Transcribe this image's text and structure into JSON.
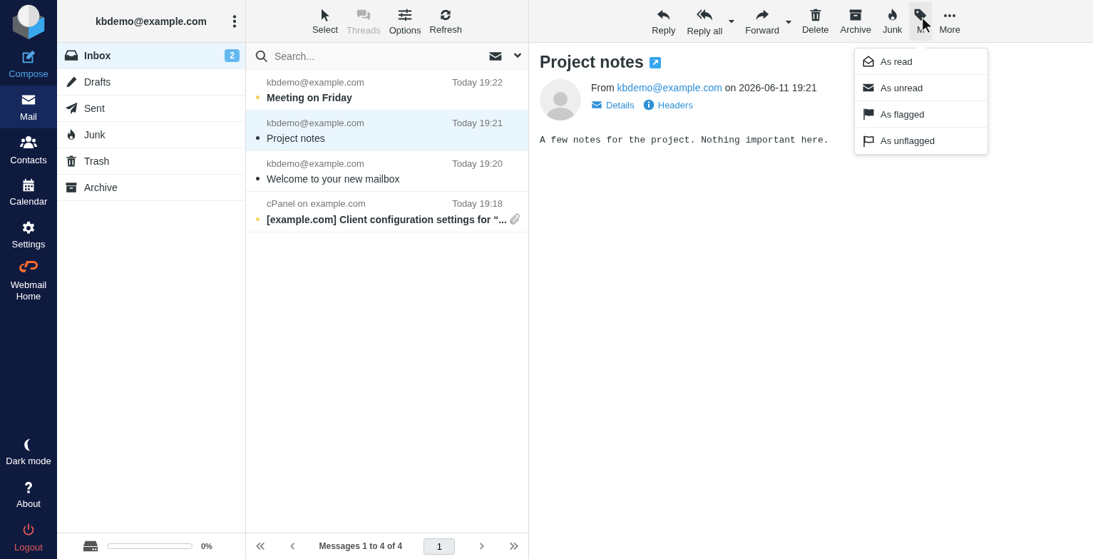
{
  "nav": {
    "items": [
      {
        "label": "Compose",
        "kind": "action",
        "selected": false
      },
      {
        "label": "Mail",
        "kind": "section",
        "selected": true
      },
      {
        "label": "Contacts",
        "kind": "section",
        "selected": false
      },
      {
        "label": "Calendar",
        "kind": "section",
        "selected": false
      },
      {
        "label": "Settings",
        "kind": "section",
        "selected": false
      },
      {
        "label": "Webmail Home",
        "kind": "home",
        "selected": false
      }
    ],
    "bottom": [
      {
        "label": "Dark mode",
        "kind": "section"
      },
      {
        "label": "About",
        "kind": "section"
      },
      {
        "label": "Logout",
        "kind": "logout"
      }
    ]
  },
  "account": {
    "email": "kbdemo@example.com"
  },
  "folders": [
    {
      "name": "Inbox",
      "selected": true,
      "unread": "2"
    },
    {
      "name": "Drafts",
      "selected": false
    },
    {
      "name": "Sent",
      "selected": false
    },
    {
      "name": "Junk",
      "selected": false
    },
    {
      "name": "Trash",
      "selected": false
    },
    {
      "name": "Archive",
      "selected": false
    }
  ],
  "quota": {
    "level": 0,
    "reading": "0%"
  },
  "list_toolbar": [
    {
      "label": "Select",
      "disabled": false
    },
    {
      "label": "Threads",
      "disabled": true
    },
    {
      "label": "Options",
      "disabled": false
    },
    {
      "label": "Refresh",
      "disabled": false
    }
  ],
  "search": {
    "placeholder": "Search..."
  },
  "messages": [
    {
      "from": "kbdemo@example.com",
      "date": "Today 19:22",
      "subject": "Meeting on Friday",
      "unread": true,
      "selected": false,
      "attachment": false
    },
    {
      "from": "kbdemo@example.com",
      "date": "Today 19:21",
      "subject": "Project notes",
      "unread": false,
      "selected": true,
      "attachment": false
    },
    {
      "from": "kbdemo@example.com",
      "date": "Today 19:20",
      "subject": "Welcome to your new mailbox",
      "unread": false,
      "selected": false,
      "attachment": false
    },
    {
      "from": "cPanel on example.com",
      "date": "Today 19:18",
      "subject": "[example.com] Client configuration settings for “...",
      "unread": true,
      "selected": false,
      "attachment": true
    }
  ],
  "pager": {
    "status": "Messages 1 to 4 of 4",
    "page": "1"
  },
  "message_toolbar": [
    {
      "label": "Reply",
      "dropdown": false,
      "active": false
    },
    {
      "label": "Reply all",
      "dropdown": true,
      "active": false
    },
    {
      "label": "Forward",
      "dropdown": true,
      "active": false
    },
    {
      "label": "Delete",
      "dropdown": false,
      "active": false
    },
    {
      "label": "Archive",
      "dropdown": false,
      "active": false
    },
    {
      "label": "Junk",
      "dropdown": false,
      "active": false
    },
    {
      "label": "M",
      "dropdown": false,
      "active": true
    },
    {
      "label": "More",
      "dropdown": false,
      "active": false
    }
  ],
  "mark_menu": [
    {
      "label": "As read"
    },
    {
      "label": "As unread"
    },
    {
      "label": "As flagged"
    },
    {
      "label": "As unflagged"
    }
  ],
  "message": {
    "subject": "Project notes",
    "from_label": "From",
    "sender": "kbdemo@example.com",
    "date_text": "on 2026-06-11 19:21",
    "links": [
      "Details",
      "Headers"
    ],
    "body": "A few notes for the project. Nothing important here."
  }
}
